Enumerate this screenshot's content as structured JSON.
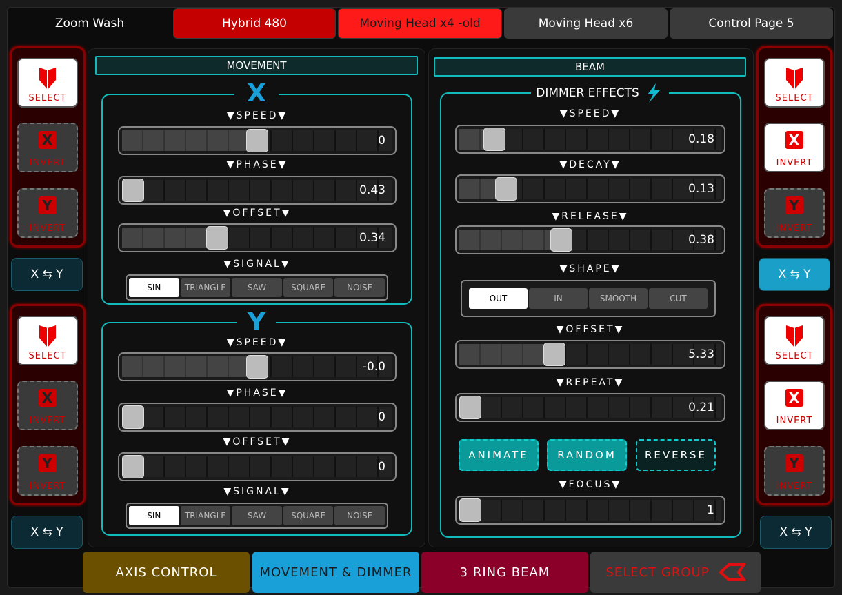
{
  "tabs": [
    {
      "label": "Zoom Wash",
      "bg": "#0c0c0c",
      "color": "#ffffff"
    },
    {
      "label": "Hybrid 480",
      "bg": "#c40000",
      "color": "#ffffff"
    },
    {
      "label": "Moving Head x4 -old",
      "bg": "#ff1a1a",
      "color": "#1a1a1a"
    },
    {
      "label": "Moving Head x6",
      "bg": "#3a3a3a",
      "color": "#ffffff"
    },
    {
      "label": "Control Page 5",
      "bg": "#3a3a3a",
      "color": "#ffffff"
    }
  ],
  "side": {
    "select": "SELECT",
    "invert": "INVERT",
    "x": "X",
    "y": "Y",
    "swap": "X ⇆ Y"
  },
  "movement": {
    "header": "MOVEMENT",
    "x_title": "X",
    "y_title": "Y",
    "x": {
      "speed_label": "▼SPEED▼",
      "speed_val": "0",
      "speed_pos": 0.5,
      "phase_label": "▼PHASE▼",
      "phase_val": "0.43",
      "phase_pos": 0.0,
      "offset_label": "▼OFFSET▼",
      "offset_val": "0.34",
      "offset_pos": 0.34,
      "signal_label": "▼SIGNAL▼"
    },
    "y": {
      "speed_label": "▼SPEED▼",
      "speed_val": "-0.0",
      "speed_pos": 0.5,
      "phase_label": "▼PHASE▼",
      "phase_val": "0",
      "phase_pos": 0.0,
      "offset_label": "▼OFFSET▼",
      "offset_val": "0",
      "offset_pos": 0.0,
      "signal_label": "▼SIGNAL▼"
    },
    "signals": [
      "SIN",
      "TRIANGLE",
      "SAW",
      "SQUARE",
      "NOISE"
    ]
  },
  "beam": {
    "header": "BEAM",
    "dimmer_title": "DIMMER EFFECTS",
    "speed_label": "▼SPEED▼",
    "speed_val": "0.18",
    "speed_pos": 0.1,
    "decay_label": "▼DECAY▼",
    "decay_val": "0.13",
    "decay_pos": 0.15,
    "release_label": "▼RELEASE▼",
    "release_val": "0.38",
    "release_pos": 0.38,
    "shape_label": "▼SHAPE▼",
    "shapes": [
      "OUT",
      "IN",
      "SMOOTH",
      "CUT"
    ],
    "offset_label": "▼OFFSET▼",
    "offset_val": "5.33",
    "offset_pos": 0.35,
    "repeat_label": "▼REPEAT▼",
    "repeat_val": "0.21",
    "repeat_pos": 0.0,
    "animate": "ANIMATE",
    "random": "RANDOM",
    "reverse": "REVERSE",
    "focus_label": "▼FOCUS▼",
    "focus_val": "1",
    "focus_pos": 0.0
  },
  "bottom_tabs": [
    {
      "label": "AXIS CONTROL",
      "bg": "#6b5000",
      "color": "#ffffff"
    },
    {
      "label": "MOVEMENT &  DIMMER",
      "bg": "#1aa0d8",
      "color": "#1a1a1a"
    },
    {
      "label": "3 RING BEAM",
      "bg": "#8a0028",
      "color": "#ffffff"
    },
    {
      "label": "SELECT GROUP",
      "bg": "#3a3a3a",
      "color": "#e01010"
    }
  ]
}
